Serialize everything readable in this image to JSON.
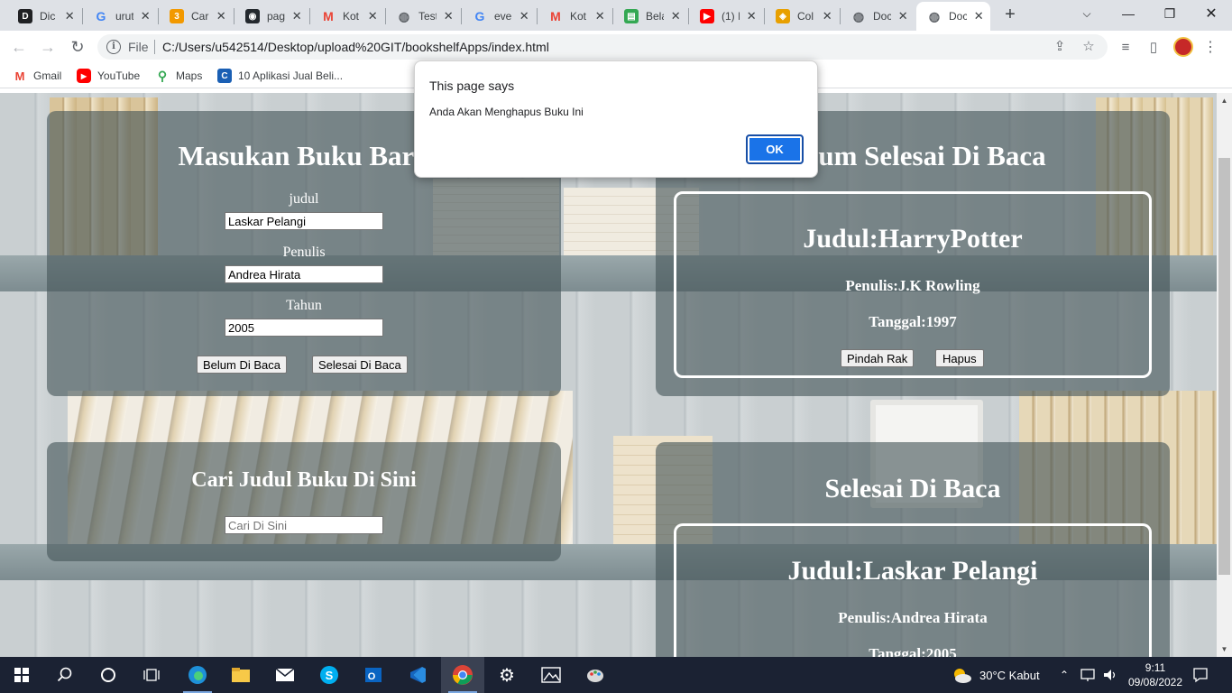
{
  "browser": {
    "tabs": [
      {
        "label": "Dic",
        "icon": "dictionary-icon",
        "color": "#202124"
      },
      {
        "label": "urut",
        "icon": "google-icon",
        "color": "#4285f4"
      },
      {
        "label": "Car",
        "icon": "bookmark-3-icon",
        "color": "#f29900"
      },
      {
        "label": "pag",
        "icon": "github-icon",
        "color": "#24292e"
      },
      {
        "label": "Kot",
        "icon": "gmail-icon",
        "color": "#ea4335"
      },
      {
        "label": "Test",
        "icon": "globe-icon",
        "color": "#5f6368"
      },
      {
        "label": "eve",
        "icon": "google-icon",
        "color": "#4285f4"
      },
      {
        "label": "Kot",
        "icon": "gmail-icon",
        "color": "#ea4335"
      },
      {
        "label": "Bela",
        "icon": "book-icon",
        "color": "#34a853"
      },
      {
        "label": "(1) I",
        "icon": "youtube-icon",
        "color": "#ff0000"
      },
      {
        "label": "Col",
        "icon": "shield-icon",
        "color": "#e8a000"
      },
      {
        "label": "Doc",
        "icon": "globe-icon",
        "color": "#5f6368"
      },
      {
        "label": "Doc",
        "icon": "globe-icon",
        "color": "#5f6368"
      }
    ],
    "active_tab_index": 12,
    "address": {
      "scheme_label": "File",
      "url": "C:/Users/u542514/Desktop/upload%20GIT/bookshelfApps/index.html"
    },
    "bookmarks": [
      {
        "label": "Gmail",
        "icon": "gmail-icon"
      },
      {
        "label": "YouTube",
        "icon": "youtube-icon"
      },
      {
        "label": "Maps",
        "icon": "maps-pin-icon"
      },
      {
        "label": "10 Aplikasi Jual Beli...",
        "icon": "site-icon"
      }
    ]
  },
  "input_panel": {
    "title": "Masukan Buku Baru",
    "judul_label": "judul",
    "judul_value": "Laskar Pelangi",
    "penulis_label": "Penulis",
    "penulis_value": "Andrea Hirata",
    "tahun_label": "Tahun",
    "tahun_value": "2005",
    "btn_unread": "Belum Di Baca",
    "btn_read": "Selesai Di Baca"
  },
  "search_panel": {
    "title": "Cari Judul Buku Di Sini",
    "placeholder": "Cari Di Sini"
  },
  "unread_panel": {
    "title": "Belum Selesai Di Baca",
    "books": [
      {
        "title": "Judul:HarryPotter",
        "author": "Penulis:J.K Rowling",
        "year": "Tanggal:1997",
        "btn_move": "Pindah Rak",
        "btn_delete": "Hapus"
      }
    ]
  },
  "read_panel": {
    "title": "Selesai Di Baca",
    "books": [
      {
        "title": "Judul:Laskar Pelangi",
        "author": "Penulis:Andrea Hirata",
        "year": "Tanggal:2005"
      }
    ]
  },
  "dialog": {
    "title": "This page says",
    "message": "Anda Akan Menghapus Buku Ini",
    "ok_label": "OK"
  },
  "taskbar": {
    "weather": "30°C  Kabut",
    "time": "9:11",
    "date": "09/08/2022"
  }
}
